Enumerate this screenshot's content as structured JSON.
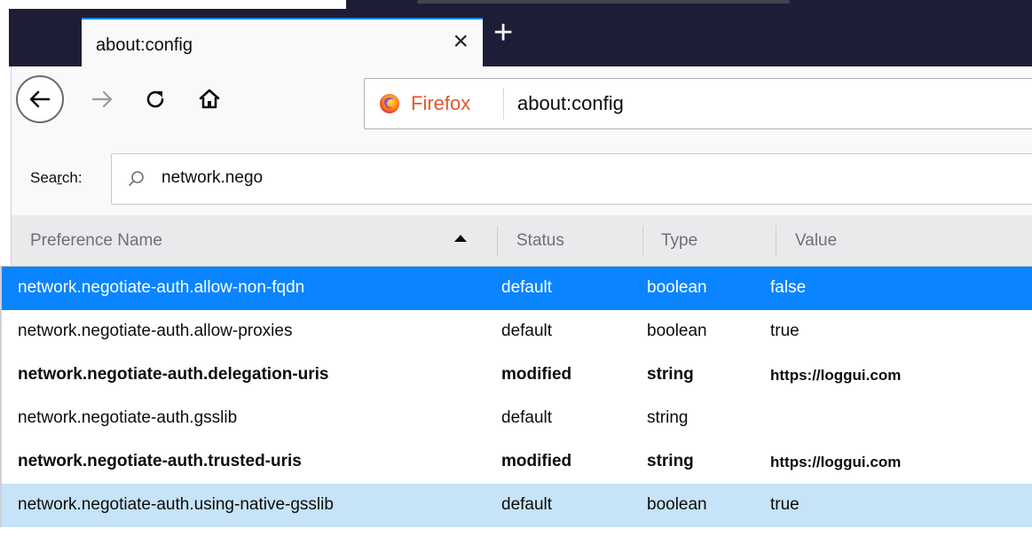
{
  "window": {
    "tab_title": "about:config",
    "new_tab_symbol": "+",
    "close_tab_symbol": "×"
  },
  "navbar": {
    "identity_label": "Firefox",
    "url": "about:config",
    "icons": [
      "back-arrow-icon",
      "forward-arrow-icon",
      "reload-icon",
      "home-icon",
      "firefox-logo-icon"
    ]
  },
  "search": {
    "label_prefix": "Sea",
    "label_accesskey": "r",
    "label_suffix": "ch:",
    "value": "network.nego",
    "icon": "search-icon"
  },
  "columns": {
    "name": "Preference Name",
    "status": "Status",
    "type": "Type",
    "value": "Value",
    "sorted_by": "name",
    "sort_direction": "ascending"
  },
  "rows": [
    {
      "name": "network.negotiate-auth.allow-non-fqdn",
      "status": "default",
      "type": "boolean",
      "value": "false",
      "state": "selected"
    },
    {
      "name": "network.negotiate-auth.allow-proxies",
      "status": "default",
      "type": "boolean",
      "value": "true",
      "state": "normal"
    },
    {
      "name": "network.negotiate-auth.delegation-uris",
      "status": "modified",
      "type": "string",
      "value": "https://loggui.com",
      "state": "modified"
    },
    {
      "name": "network.negotiate-auth.gsslib",
      "status": "default",
      "type": "string",
      "value": "",
      "state": "normal"
    },
    {
      "name": "network.negotiate-auth.trusted-uris",
      "status": "modified",
      "type": "string",
      "value": "https://loggui.com",
      "state": "modified"
    },
    {
      "name": "network.negotiate-auth.using-native-gsslib",
      "status": "default",
      "type": "boolean",
      "value": "true",
      "state": "hover"
    }
  ],
  "colors": {
    "tabbar_bg": "#1e1d37",
    "accent": "#0a84ff",
    "selected_row": "#0a84ff",
    "hover_row": "#c7e3f7",
    "firefox_label": "#e1572e"
  }
}
